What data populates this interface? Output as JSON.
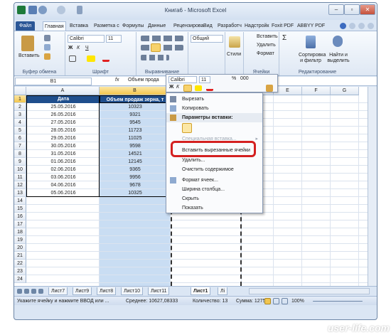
{
  "window": {
    "title": "Книга6 - Microsoft Excel"
  },
  "tabs": [
    "Файл",
    "Главная",
    "Вставка",
    "Разметка с",
    "Формулы",
    "Данные",
    "Рецензирова",
    "Вид",
    "Разработч",
    "Надстройк",
    "Foxit PDF",
    "ABBYY PDF"
  ],
  "ribbon": {
    "paste": "Вставить",
    "clipboard": "Буфер обмена",
    "font_name": "Calibri",
    "font_size": "11",
    "bold": "Ж",
    "italic": "К",
    "underline": "Ч",
    "font": "Шрифт",
    "align": "Выравнивание",
    "number_format": "Общий",
    "styles": "Стили",
    "insert": "Вставить",
    "delete": "Удалить",
    "format": "Формат",
    "cells": "Ячейки",
    "sort": "Сортировка и фильтр",
    "find": "Найти и выделить",
    "editing": "Редактирование",
    "sigma": "Σ"
  },
  "formula_bar": {
    "name_box": "B1",
    "fx": "fx",
    "content": "Объем прода"
  },
  "columns": [
    "A",
    "B",
    "C",
    "D",
    "E",
    "F",
    "G"
  ],
  "rows": [
    "1",
    "2",
    "3",
    "4",
    "5",
    "6",
    "7",
    "8",
    "9",
    "10",
    "11",
    "12",
    "13",
    "14",
    "15",
    "16",
    "17",
    "18",
    "19",
    "20",
    "21",
    "22",
    "23",
    "24"
  ],
  "table": {
    "header_a": "Дата",
    "header_b": "Объем продаж зерна, т",
    "dates": [
      "25.05.2016",
      "26.05.2016",
      "27.05.2016",
      "28.05.2016",
      "29.05.2016",
      "30.05.2016",
      "31.05.2016",
      "01.06.2016",
      "02.06.2016",
      "03.06.2016",
      "04.06.2016",
      "05.06.2016"
    ],
    "values": [
      "10323",
      "9321",
      "9545",
      "11723",
      "11025",
      "9598",
      "14521",
      "12145",
      "9365",
      "9956",
      "9678",
      "10325"
    ]
  },
  "context_menu": {
    "cut": "Вырезать",
    "copy": "Копировать",
    "paste_options": "Параметры вставки:",
    "paste_special": "Специальная вставка...",
    "insert_cut": "Вставить вырезанные ячейки",
    "delete": "Удалить...",
    "clear": "Очистить содержимое",
    "format_cells": "Формат ячеек...",
    "col_width": "Ширина столбца...",
    "hide": "Скрыть",
    "show": "Показать"
  },
  "mini_toolbar": {
    "font": "Calibri",
    "size": "11",
    "bold": "Ж",
    "italic": "К",
    "percent": "%",
    "thousand": "000"
  },
  "sheets": [
    "Лист7",
    "Лист9",
    "Лист8",
    "Лист10",
    "Лист11",
    "Лист1",
    "Лі"
  ],
  "status": {
    "hint": "Укажите ячейку и нажмите ВВОД или ...",
    "avg": "Среднее: 10627,08333",
    "count": "Количество: 13",
    "sum": "Сумма: 127525",
    "zoom": "100%"
  },
  "watermark": "user-life.com",
  "colors": {
    "accent": "#2a5a9a",
    "selection": "#c9ddf3",
    "header_fill": "#1f4e8c",
    "highlight_row": "#f5c242",
    "red": "#d42020"
  }
}
